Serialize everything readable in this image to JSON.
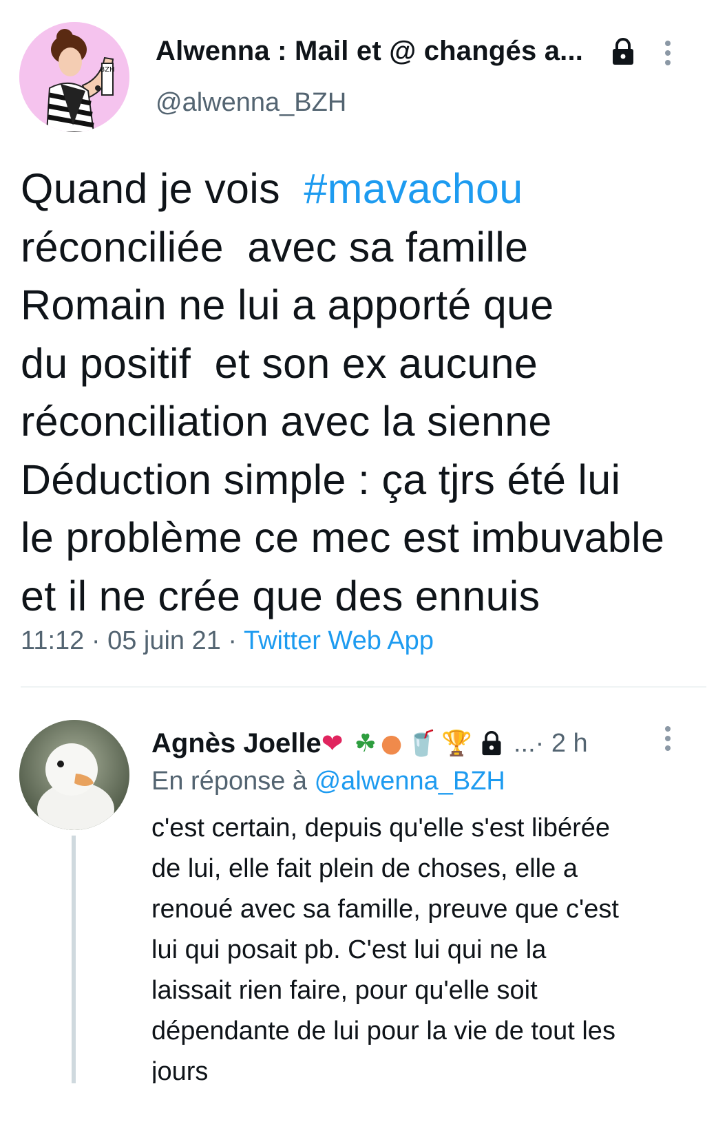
{
  "main_tweet": {
    "author_name": "Alwenna : Mail et @ changés a...",
    "handle": "@alwenna_BZH",
    "text_before": "Quand je vois  ",
    "hashtag": "#mavachou",
    "text_after": "\nréconciliée  avec sa famille\nRomain ne lui a apporté que\ndu positif  et son ex aucune\nréconciliation avec la sienne\nDéduction simple : ça tjrs été lui\nle problème ce mec est imbuvable\net il ne crée que des ennuis",
    "time": "11:12",
    "separator": " · ",
    "date": "05 juin 21",
    "source_app": "Twitter Web App",
    "avatar_badge": "BZH"
  },
  "reply": {
    "author_name": "Agnès Joelle",
    "emojis": {
      "heart": "❤",
      "clover": "☘",
      "peach": "●",
      "glass": "🥤",
      "trophy": "🏆"
    },
    "ellipsis": "...",
    "time": " · 2 h",
    "in_reply_label": "En réponse à ",
    "in_reply_mention": "@alwenna_BZH",
    "text": "c'est certain, depuis qu'elle s'est libérée\nde lui, elle fait plein de choses, elle a\nrenoué avec sa famille, preuve que c'est\nlui qui posait pb. C'est lui qui ne la\nlaissait rien faire, pour qu'elle soit\ndépendante de lui pour la vie de tout les\njours"
  },
  "icons": {
    "lock": "lock-icon",
    "more": "more-options-icon"
  },
  "colors": {
    "link": "#1d9bf0",
    "secondary_text": "#536471",
    "text": "#0f1419",
    "divider": "#eff3f4",
    "thread_line": "#cfd9de"
  }
}
